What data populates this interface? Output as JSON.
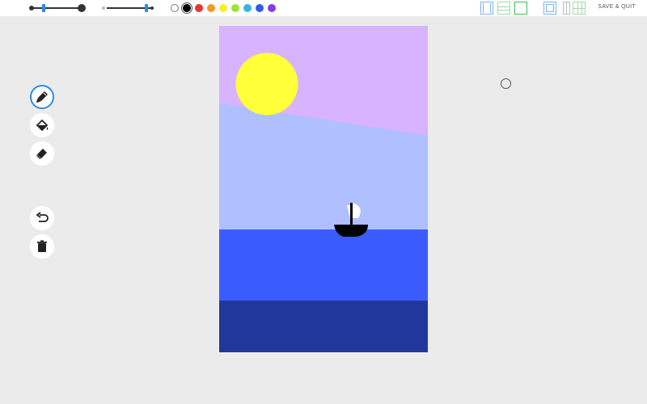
{
  "toolbar": {
    "brush_size_slider": {
      "value_fraction": 0.2
    },
    "opacity_slider": {
      "value_fraction": 0.9
    },
    "palette": [
      {
        "name": "white",
        "hex": "#ffffff"
      },
      {
        "name": "black",
        "hex": "#000000",
        "selected": true
      },
      {
        "name": "red",
        "hex": "#e8342d"
      },
      {
        "name": "orange",
        "hex": "#f5962a"
      },
      {
        "name": "yellow",
        "hex": "#f7ee2c"
      },
      {
        "name": "lime",
        "hex": "#9ae633"
      },
      {
        "name": "cyan",
        "hex": "#33b5e5"
      },
      {
        "name": "blue",
        "hex": "#2e5bea"
      },
      {
        "name": "purple",
        "hex": "#8a3ae3"
      }
    ],
    "layout_icons": [
      "single-page-icon",
      "two-row-icon",
      "full-frame-icon",
      "portrait-frame-icon",
      "two-column-icon",
      "grid-icon"
    ],
    "save_quit_label": "SAVE & QUIT"
  },
  "tools": [
    "brush-icon",
    "fill-bucket-icon",
    "eraser-icon",
    "undo-icon",
    "trash-icon"
  ],
  "active_tool": "brush",
  "colors": {
    "accent": "#2a8de0",
    "sky": "#d8b3ff",
    "sky_lower": "#b0bfff",
    "sun": "#ffff3a",
    "sea": "#3a5cff",
    "deep_sea": "#22379c"
  }
}
